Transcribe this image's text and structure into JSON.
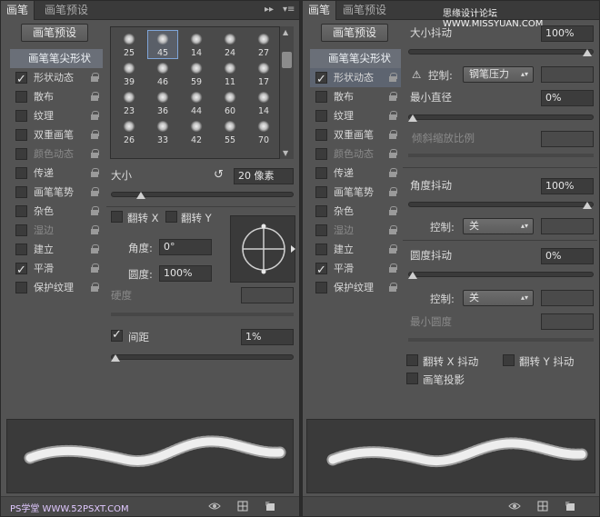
{
  "left": {
    "tabs": [
      "画笔",
      "画笔预设"
    ],
    "preset_button": "画笔预设",
    "categories": [
      {
        "label": "画笔笔尖形状",
        "header": true
      },
      {
        "label": "形状动态",
        "checked": true,
        "lock": true
      },
      {
        "label": "散布",
        "checked": false,
        "lock": true
      },
      {
        "label": "纹理",
        "checked": false,
        "lock": true
      },
      {
        "label": "双重画笔",
        "checked": false,
        "lock": true
      },
      {
        "label": "颜色动态",
        "checked": false,
        "lock": true,
        "dim": true
      },
      {
        "label": "传递",
        "checked": false,
        "lock": true
      },
      {
        "label": "画笔笔势",
        "checked": false,
        "lock": true
      },
      {
        "label": "杂色",
        "checked": false,
        "lock": true
      },
      {
        "label": "湿边",
        "checked": false,
        "lock": true,
        "dim": true
      },
      {
        "label": "建立",
        "checked": false,
        "lock": true
      },
      {
        "label": "平滑",
        "checked": true,
        "lock": true
      },
      {
        "label": "保护纹理",
        "checked": false,
        "lock": true
      }
    ],
    "brush_sizes": [
      "25",
      "45",
      "14",
      "24",
      "27",
      "39",
      "46",
      "59",
      "11",
      "17",
      "23",
      "36",
      "44",
      "60",
      "14",
      "26",
      "33",
      "42",
      "55",
      "70"
    ],
    "selected_brush_index": 1,
    "size_label": "大小",
    "size_value": "20 像素",
    "size_slider": 0.15,
    "flip_x": "翻转 X",
    "flip_y": "翻转 Y",
    "angle_label": "角度:",
    "angle_value": "0°",
    "roundness_label": "圆度:",
    "roundness_value": "100%",
    "hardness_label": "硬度",
    "spacing_label": "间距",
    "spacing_checked": true,
    "spacing_value": "1%",
    "spacing_slider": 0.0,
    "watermark": "PS学堂 WWW.52PSXT.COM"
  },
  "right": {
    "tabs": [
      "画笔",
      "画笔预设"
    ],
    "site_watermark": "思缘设计论坛 WWW.MISSYUAN.COM",
    "preset_button": "画笔预设",
    "categories": [
      {
        "label": "画笔笔尖形状",
        "header": true
      },
      {
        "label": "形状动态",
        "checked": true,
        "lock": true,
        "selected": true
      },
      {
        "label": "散布",
        "checked": false,
        "lock": true
      },
      {
        "label": "纹理",
        "checked": false,
        "lock": true
      },
      {
        "label": "双重画笔",
        "checked": false,
        "lock": true
      },
      {
        "label": "颜色动态",
        "checked": false,
        "lock": true,
        "dim": true
      },
      {
        "label": "传递",
        "checked": false,
        "lock": true
      },
      {
        "label": "画笔笔势",
        "checked": false,
        "lock": true
      },
      {
        "label": "杂色",
        "checked": false,
        "lock": true
      },
      {
        "label": "湿边",
        "checked": false,
        "lock": true,
        "dim": true
      },
      {
        "label": "建立",
        "checked": false,
        "lock": true
      },
      {
        "label": "平滑",
        "checked": true,
        "lock": true
      },
      {
        "label": "保护纹理",
        "checked": false,
        "lock": true
      }
    ],
    "size_jitter_label": "大小抖动",
    "size_jitter_value": "100%",
    "size_jitter_slider": 1.0,
    "control_label": "控制:",
    "control_value_1": "钢笔压力",
    "min_diameter_label": "最小直径",
    "min_diameter_value": "0%",
    "min_diameter_slider": 0.0,
    "tilt_scale_label": "倾斜缩放比例",
    "angle_jitter_label": "角度抖动",
    "angle_jitter_value": "100%",
    "angle_jitter_slider": 1.0,
    "control_value_2": "关",
    "roundness_jitter_label": "圆度抖动",
    "roundness_jitter_value": "0%",
    "roundness_jitter_slider": 0.0,
    "control_value_3": "关",
    "min_roundness_label": "最小圆度",
    "flip_x_jitter": "翻转 X 抖动",
    "flip_y_jitter": "翻转 Y 抖动",
    "brush_projection": "画笔投影"
  }
}
